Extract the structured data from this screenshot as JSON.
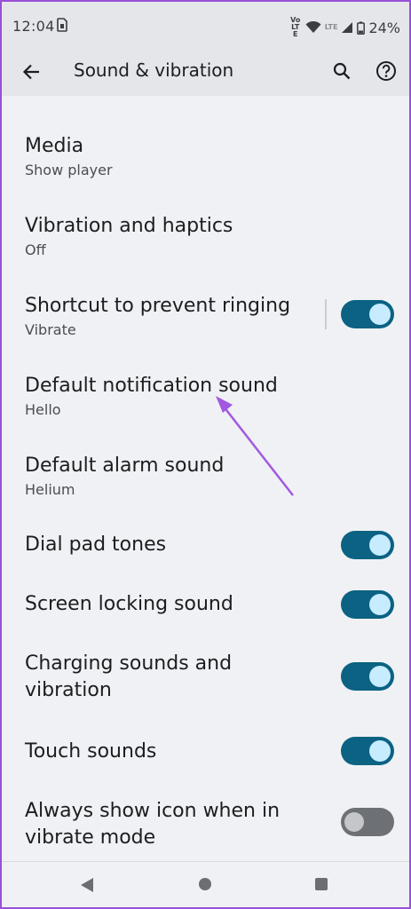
{
  "status_bar": {
    "time": "12:04",
    "volte_label": "Vo LTE",
    "lte_label": "LTE",
    "battery_percent": "24%"
  },
  "app_bar": {
    "title": "Sound & vibration",
    "back_icon": "arrow-back-icon",
    "search_icon": "search-icon",
    "help_icon": "help-icon"
  },
  "settings": [
    {
      "title": "Media",
      "subtitle": "Show player"
    },
    {
      "title": "Vibration and haptics",
      "subtitle": "Off"
    },
    {
      "title": "Shortcut to prevent ringing",
      "subtitle": "Vibrate",
      "toggle": true
    },
    {
      "title": "Default notification sound",
      "subtitle": "Hello"
    },
    {
      "title": "Default alarm sound",
      "subtitle": "Helium"
    },
    {
      "title": "Dial pad tones",
      "toggle": true
    },
    {
      "title": "Screen locking sound",
      "toggle": true
    },
    {
      "title": "Charging sounds and vibration",
      "title_line1": "Charging sounds and",
      "title_line2": "vibration",
      "toggle": true
    },
    {
      "title": "Touch sounds",
      "toggle": true
    },
    {
      "title": "Always show icon when in vibrate mode",
      "title_line1": "Always show icon when in",
      "title_line2": "vibrate mode",
      "toggle": false
    }
  ],
  "colors": {
    "accent": "#0b6283",
    "annotation_arrow": "#a259e0",
    "frame": "#9a4fd6"
  },
  "nav_bar": {
    "back_icon": "nav-back-icon",
    "home_icon": "nav-home-icon",
    "recents_icon": "nav-recents-icon"
  }
}
